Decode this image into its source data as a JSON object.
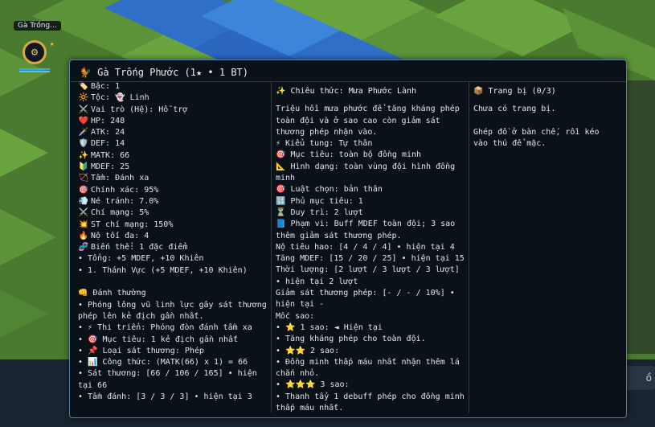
{
  "unit": {
    "name_tag": "Gà Trống...",
    "badge_icon": "gear-shield-icon",
    "star": "★"
  },
  "tooltip": {
    "title": "🐓 Gà Trống Phước (1★ • 1 BT)",
    "stats": [
      {
        "icon": "🏷️",
        "text": "Bậc: 1"
      },
      {
        "icon": "🔆",
        "text": "Tộc: 👻 Linh"
      },
      {
        "icon": "⚔️",
        "text": "Vai trò (Hệ): Hỗ trợ"
      },
      {
        "icon": "❤️",
        "text": "HP: 248"
      },
      {
        "icon": "🗡️",
        "text": "ATK: 24"
      },
      {
        "icon": "🛡️",
        "text": "DEF: 14"
      },
      {
        "icon": "✨",
        "text": "MATK: 66"
      },
      {
        "icon": "🔰",
        "text": "MDEF: 25"
      },
      {
        "icon": "🏹",
        "text": "Tầm: Đánh xa"
      },
      {
        "icon": "🎯",
        "text": "Chính xác: 95%"
      },
      {
        "icon": "💨",
        "text": "Né tránh: 7.0%"
      },
      {
        "icon": "⚔️",
        "text": "Chí mạng: 5%"
      },
      {
        "icon": "💥",
        "text": "ST chí mạng: 150%"
      },
      {
        "icon": "🔥",
        "text": "Nộ tối đa: 4"
      },
      {
        "icon": "🧬",
        "text": "Biến thể: 1 đặc điểm"
      },
      {
        "icon": "",
        "text": "• Tổng: +5 MDEF, +10 Khiên"
      },
      {
        "icon": "",
        "text": "• 1. Thánh Vực (+5 MDEF, +10 Khiên)"
      }
    ],
    "basic_attack": {
      "header": "👊 Đánh thường",
      "description": "• Phóng lông vũ linh lực gây sát thương phép lên kẻ địch gần nhất.",
      "lines": [
        "• ⚡ Thi triển: Phóng đòn đánh tầm xa",
        "• 🎯 Mục tiêu: 1 kẻ địch gần nhất",
        "• 📌 Loại sát thương: Phép",
        "• 📊 Công thức: (MATK(66) x 1) = 66",
        "• Sát thương: [66 / 106 / 165] • hiện tại 66",
        "• Tầm đánh: [3 / 3 / 3] • hiện tại 3"
      ]
    },
    "skill": {
      "header": "✨ Chiêu thức: Mưa Phước Lành",
      "description": "Triệu hồi mưa phước để tăng kháng phép toàn đội và ở sao cao còn giảm sát thương phép nhận vào.",
      "lines": [
        "⚡ Kiểu tung: Tự thân",
        "🎯 Mục tiêu: toàn bộ đồng minh",
        "📐 Hình dạng: toàn vùng đội hình đồng minh",
        "🎯 Luật chọn: bản thân",
        "🔢 Phủ mục tiêu: 1",
        "⏳ Duy trì: 2 lượt",
        "📘 Phạm vi: Buff MDEF toàn đội; 3 sao thêm giảm sát thương phép.",
        "Nộ tiêu hao: [4 / 4 / 4] • hiện tại 4",
        "Tăng MDEF: [15 / 20 / 25] • hiện tại 15",
        "Thời lượng: [2 lượt / 3 lượt / 3 lượt] • hiện tại 2 lượt",
        "Giảm sát thương phép: [- / - / 10%] • hiện tại -",
        "Mốc sao:",
        "• ⭐ 1 sao: ◄ Hiện tại",
        "• Tăng kháng phép cho toàn đội.",
        "• ⭐⭐ 2 sao:",
        "• Đồng minh thấp máu nhất nhận thêm lá chắn nhỏ.",
        "• ⭐⭐⭐ 3 sao:",
        "• Thanh tẩy 1 debuff phép cho đồng minh thấp máu nhất."
      ]
    },
    "equipment": {
      "header": "📦 Trang bị (0/3)",
      "empty": "Chưa có trang bị.",
      "hint": "Ghép đồ ở bàn chế, rồi kéo vào thú để mặc."
    }
  },
  "right_input": {
    "value": "ồ"
  }
}
